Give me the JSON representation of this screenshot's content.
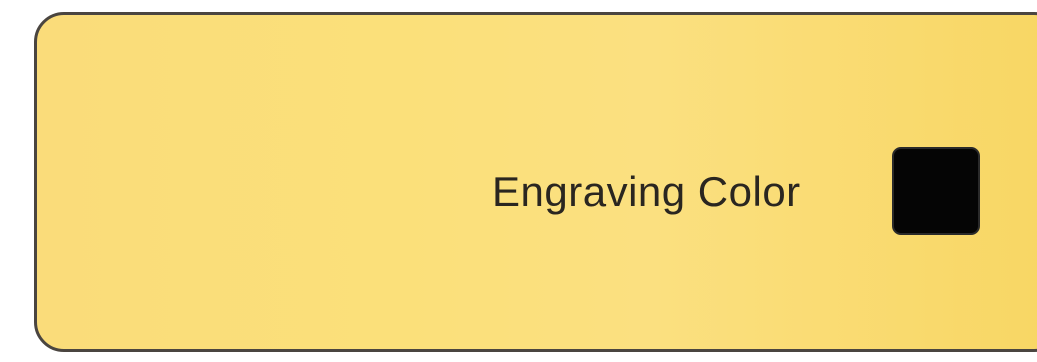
{
  "engraving": {
    "label": "Engraving Color",
    "color_value": "#050505",
    "panel_color": "#fbe07a"
  }
}
